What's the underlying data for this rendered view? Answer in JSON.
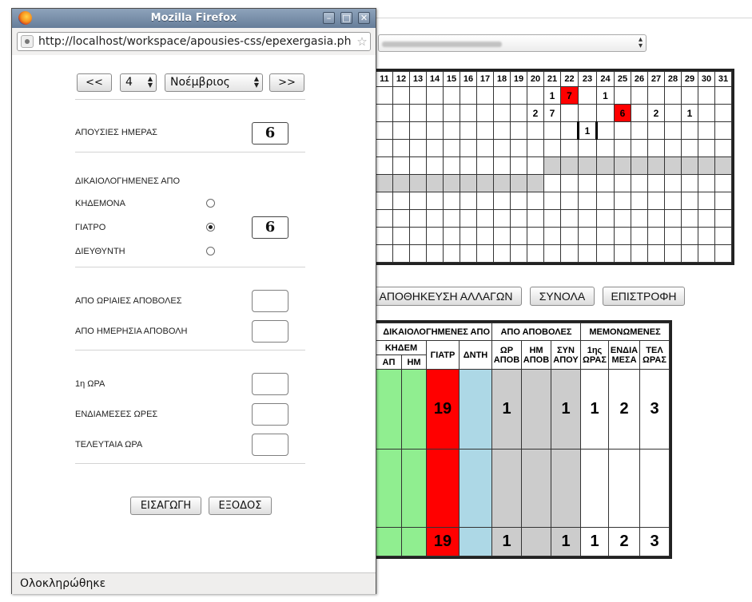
{
  "background": {
    "grid_header_days": [
      "11",
      "12",
      "13",
      "14",
      "15",
      "16",
      "17",
      "18",
      "19",
      "20",
      "21",
      "22",
      "23",
      "24",
      "25",
      "26",
      "27",
      "28",
      "29",
      "30",
      "31"
    ],
    "grid_rows": [
      [
        "",
        "",
        "",
        "",
        "",
        "",
        "",
        "",
        "",
        "",
        "1",
        "7",
        "",
        "1",
        "",
        "",
        "",
        "",
        "",
        "",
        ""
      ],
      [
        "",
        "",
        "",
        "",
        "",
        "",
        "",
        "",
        "",
        "2",
        "7",
        "",
        "",
        "",
        "6",
        "",
        "2",
        "",
        "1",
        "",
        ""
      ],
      [
        "",
        "",
        "",
        "",
        "",
        "",
        "",
        "",
        "",
        "",
        "",
        "",
        "1",
        "",
        "",
        "",
        "",
        "",
        "",
        "",
        ""
      ],
      [
        "",
        "",
        "",
        "",
        "",
        "",
        "",
        "",
        "",
        "",
        "",
        "",
        "",
        "",
        "",
        "",
        "",
        "",
        "",
        "",
        ""
      ],
      [
        "",
        "",
        "",
        "",
        "",
        "",
        "",
        "",
        "",
        "",
        "",
        "",
        "",
        "",
        "",
        "",
        "",
        "",
        "",
        "",
        ""
      ],
      [
        "",
        "",
        "",
        "",
        "",
        "",
        "",
        "",
        "",
        "",
        "",
        "",
        "",
        "",
        "",
        "",
        "",
        "",
        "",
        "",
        ""
      ],
      [
        "",
        "",
        "",
        "",
        "",
        "",
        "",
        "",
        "",
        "",
        "",
        "",
        "",
        "",
        "",
        "",
        "",
        "",
        "",
        "",
        ""
      ],
      [
        "",
        "",
        "",
        "",
        "",
        "",
        "",
        "",
        "",
        "",
        "",
        "",
        "",
        "",
        "",
        "",
        "",
        "",
        "",
        "",
        ""
      ],
      [
        "",
        "",
        "",
        "",
        "",
        "",
        "",
        "",
        "",
        "",
        "",
        "",
        "",
        "",
        "",
        "",
        "",
        "",
        "",
        "",
        ""
      ],
      [
        "",
        "",
        "",
        "",
        "",
        "",
        "",
        "",
        "",
        "",
        "",
        "",
        "",
        "",
        "",
        "",
        "",
        "",
        "",
        "",
        ""
      ]
    ],
    "buttons": {
      "save": "ΑΠΟΘΗΚΕΥΣΗ ΑΛΛΑΓΩΝ",
      "totals": "ΣΥΝΟΛΑ",
      "back": "ΕΠΙΣΤΡΟΦΗ"
    },
    "summary": {
      "group_headers": [
        "ΔΙΚΑΙΟΛΟΓΗΜΕΝΕΣ ΑΠΟ",
        "ΑΠΟ ΑΠΟΒΟΛΕΣ",
        "ΜΕΜΟΝΩΜΕΝΕΣ"
      ],
      "khdem": "ΚΗΔΕΜ",
      "ap": "ΑΠ",
      "hm": "ΗΜ",
      "giatr": "ΓΙΑΤΡ",
      "dnth": "ΔΝΤΗ",
      "or_apov": [
        "ΩΡ",
        "ΑΠΟΒ"
      ],
      "hm_apov": [
        "ΗΜ",
        "ΑΠΟΒ"
      ],
      "syn_apoy": [
        "ΣΥΝ",
        "ΑΠΟΥ"
      ],
      "first_hour": [
        "1ης",
        "ΩΡΑΣ"
      ],
      "middle": [
        "ΕΝΔΙΑ",
        "ΜΕΣΑ"
      ],
      "last_hour": [
        "ΤΕΛ",
        "ΩΡΑΣ"
      ],
      "row1": {
        "giatr": "19",
        "or_apov": "1",
        "syn": "1",
        "first": "1",
        "middle": "2",
        "last": "3"
      },
      "total": {
        "giatr": "19",
        "or_apov": "1",
        "syn": "1",
        "first": "1",
        "middle": "2",
        "last": "3"
      }
    },
    "colors": {
      "absence_red": "#ff0000",
      "green": "#90ee90",
      "blue": "#add8e6",
      "gray": "#cccccc"
    }
  },
  "window": {
    "title": "Mozilla Firefox",
    "url": "http://localhost/workspace/apousies-css/epexergasia.ph",
    "status": "Ολοκληρώθηκε"
  },
  "form": {
    "prev_label": "<<",
    "next_label": ">>",
    "day_value": "4",
    "month_value": "Νοέμβριος",
    "day_absences_label": "ΑΠΟΥΣΙΕΣ ΗΜΕΡΑΣ",
    "day_absences_value": "6",
    "justified_label": "ΔΙΚΑΙΟΛΟΓΗΜΕΝΕΣ ΑΠΟ",
    "guardian_label": "ΚΗΔΕΜΟΝΑ",
    "doctor_label": "ΓΙΑΤΡΟ",
    "director_label": "ΔΙΕΥΘΥΝΤΗ",
    "justified_value": "6",
    "selected_justifier": "doctor",
    "hourly_expulsions_label": "ΑΠΟ ΩΡΙΑΙΕΣ ΑΠΟΒΟΛΕΣ",
    "daily_expulsion_label": "ΑΠΟ ΗΜΕΡΗΣΙΑ ΑΠΟΒΟΛΗ",
    "first_hour_label": "1η ΩΡΑ",
    "middle_hours_label": "ΕΝΔΙΑΜΕΣΕΣ ΩΡΕΣ",
    "last_hour_label": "ΤΕΛΕΥΤΑΙΑ ΩΡΑ",
    "insert_label": "ΕΙΣΑΓΩΓΗ",
    "exit_label": "ΕΞΟΔΟΣ"
  }
}
